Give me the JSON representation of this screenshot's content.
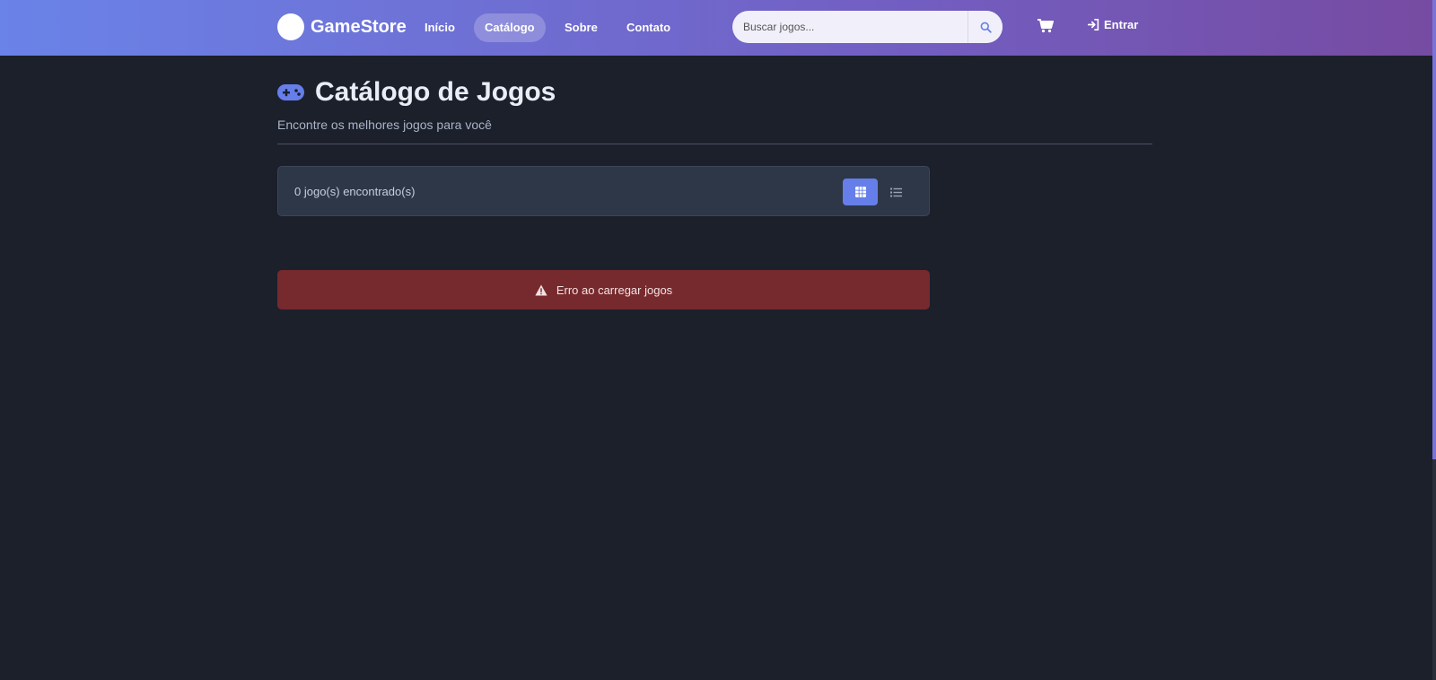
{
  "brand": {
    "name": "GameStore"
  },
  "nav": {
    "items": [
      {
        "label": "Início",
        "active": false
      },
      {
        "label": "Catálogo",
        "active": true
      },
      {
        "label": "Sobre",
        "active": false
      },
      {
        "label": "Contato",
        "active": false
      }
    ]
  },
  "search": {
    "placeholder": "Buscar jogos...",
    "value": "",
    "icon": "search-icon"
  },
  "cart": {
    "icon": "cart-icon"
  },
  "login": {
    "label": "Entrar",
    "icon": "sign-in-icon"
  },
  "page": {
    "icon": "gamepad-icon",
    "title": "Catálogo de Jogos",
    "subtitle": "Encontre os melhores jogos para você"
  },
  "results": {
    "count_text": "0 jogo(s) encontrado(s)",
    "view_modes": [
      {
        "icon": "grid-icon",
        "active": true
      },
      {
        "icon": "list-icon",
        "active": false
      }
    ]
  },
  "alert": {
    "icon": "warning-icon",
    "message": "Erro ao carregar jogos"
  },
  "colors": {
    "header_gradient_start": "#6a83e8",
    "header_gradient_end": "#764ba2",
    "background": "#1b202b",
    "accent": "#667ee9",
    "error_bg": "#762a2e"
  }
}
